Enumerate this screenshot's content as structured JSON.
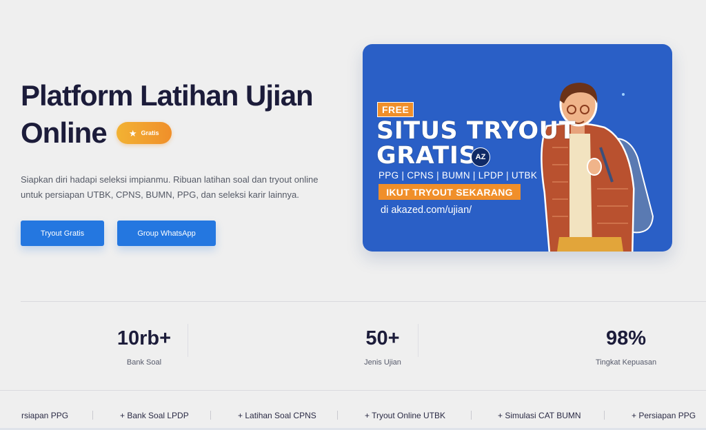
{
  "hero": {
    "title_line1": "Platform Latihan Ujian",
    "title_line2": "Online",
    "badge_label": "Gratis",
    "description": "Siapkan diri hadapi seleksi impianmu. Ribuan latihan soal dan tryout online untuk persiapan UTBK, CPNS, BUMN, PPG, dan seleksi karir lainnya.",
    "buttons": [
      {
        "label": "Tryout Gratis"
      },
      {
        "label": "Group WhatsApp"
      }
    ]
  },
  "banner": {
    "free": "FREE",
    "title_line1": "SITUS TRYOUT",
    "title_line2": "GRATIS",
    "logo": "AZ",
    "tags": "PPG | CPNS | BUMN | LPDP | UTBK",
    "cta": "IKUT TRYOUT SEKARANG",
    "url": "di akazed.com/ujian/",
    "colors": {
      "background": "#2a5fc6",
      "accent": "#f08f2a"
    }
  },
  "stats": [
    {
      "value": "10rb+",
      "label": "Bank Soal"
    },
    {
      "value": "50+",
      "label": "Jenis Ujian"
    },
    {
      "value": "98%",
      "label": "Tingkat Kepuasan"
    }
  ],
  "ticker": [
    "rsiapan PPG",
    "+ Bank Soal LPDP",
    "+ Latihan Soal CPNS",
    "+ Tryout Online UTBK",
    "+ Simulasi CAT BUMN",
    "+ Persiapan PPG"
  ],
  "colors": {
    "primary": "#2477e0",
    "heading": "#1c1c3a",
    "badge_gradient": [
      "#f2b233",
      "#f08f2a"
    ]
  }
}
